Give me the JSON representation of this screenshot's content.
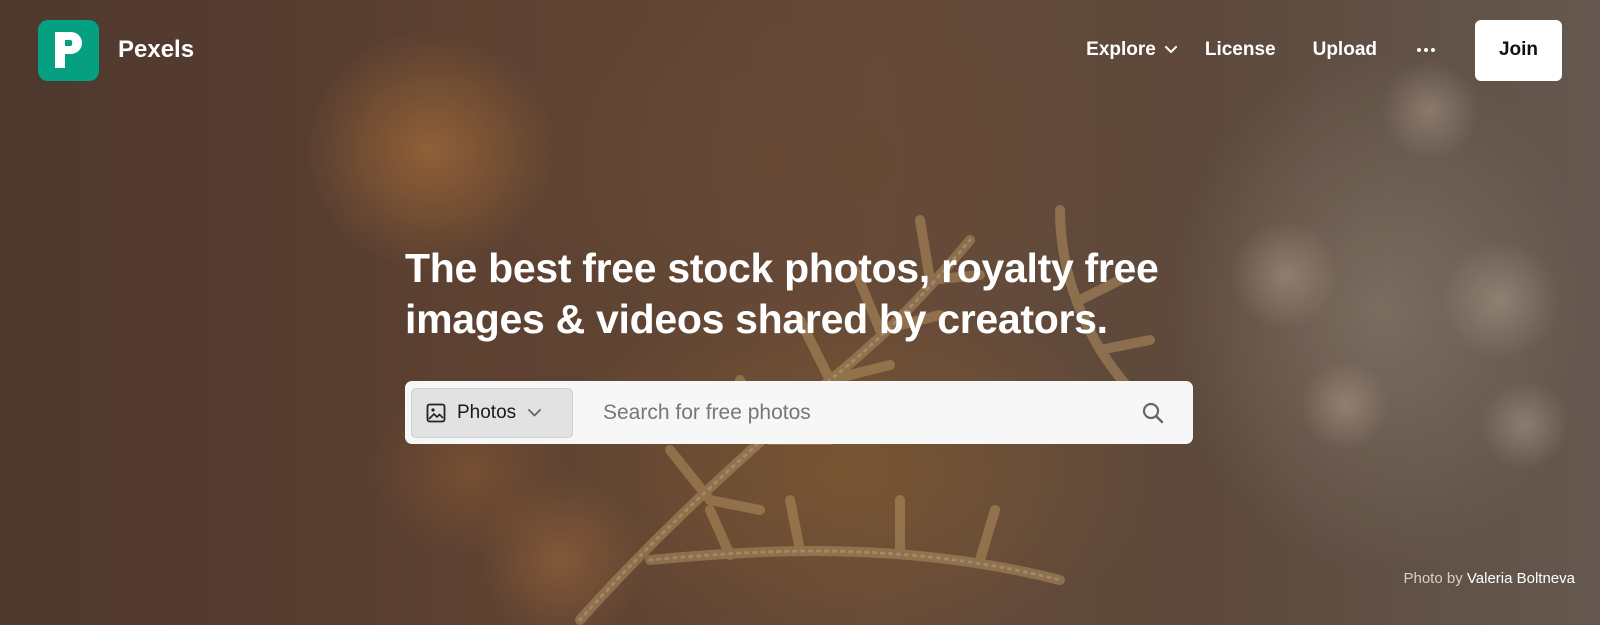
{
  "brand": {
    "name": "Pexels",
    "logo_icon": "pexels-p-logo",
    "logo_color": "#05a081"
  },
  "nav": {
    "explore": "Explore",
    "license": "License",
    "upload": "Upload",
    "more_icon": "more-dots-icon",
    "join": "Join"
  },
  "hero": {
    "headline": "The best free stock photos, royalty free images & videos shared by creators."
  },
  "search": {
    "type_label": "Photos",
    "placeholder": "Search for free photos",
    "icon": "search-icon"
  },
  "credit": {
    "prefix": "Photo by",
    "author": "Valeria Boltneva"
  }
}
